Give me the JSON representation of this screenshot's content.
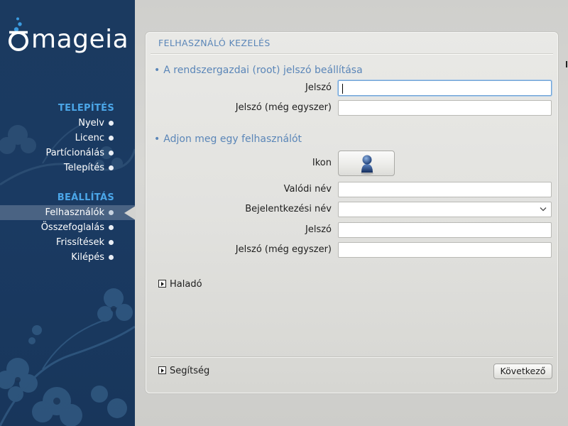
{
  "brand": {
    "logo_text": "mageia"
  },
  "sidebar": {
    "sections": [
      {
        "title": "TELEPÍTÉS",
        "items": [
          {
            "label": "Nyelv"
          },
          {
            "label": "Licenc"
          },
          {
            "label": "Partícionálás"
          },
          {
            "label": "Telepítés"
          }
        ]
      },
      {
        "title": "BEÁLLÍTÁS",
        "items": [
          {
            "label": "Felhasználók",
            "active": true
          },
          {
            "label": "Összefoglalás"
          },
          {
            "label": "Frissítések"
          },
          {
            "label": "Kilépés"
          }
        ]
      }
    ]
  },
  "panel": {
    "title": "FELHASZNÁLÓ KEZELÉS",
    "root_section": {
      "heading": "A rendszergazdai (root) jelszó beállítása",
      "bullet": "•",
      "password_label": "Jelszó",
      "password_value": "",
      "password_again_label": "Jelszó (még egyszer)",
      "password_again_value": ""
    },
    "user_section": {
      "heading": "Adjon meg egy felhasználót",
      "bullet": "•",
      "icon_label": "Ikon",
      "icon_name": "user-avatar-icon",
      "real_name_label": "Valódi név",
      "real_name_value": "",
      "login_label": "Bejelentkezési név",
      "login_value": "",
      "password_label": "Jelszó",
      "password_value": "",
      "password_again_label": "Jelszó (még egyszer)",
      "password_again_value": ""
    },
    "advanced_label": "Haladó",
    "help_label": "Segítség",
    "next_label": "Következő"
  },
  "colors": {
    "sidebar_bg": "#1b3a60",
    "section_title": "#4ba6e8",
    "panel_heading": "#5b86b8",
    "active_item_bg": "#4a6383"
  }
}
